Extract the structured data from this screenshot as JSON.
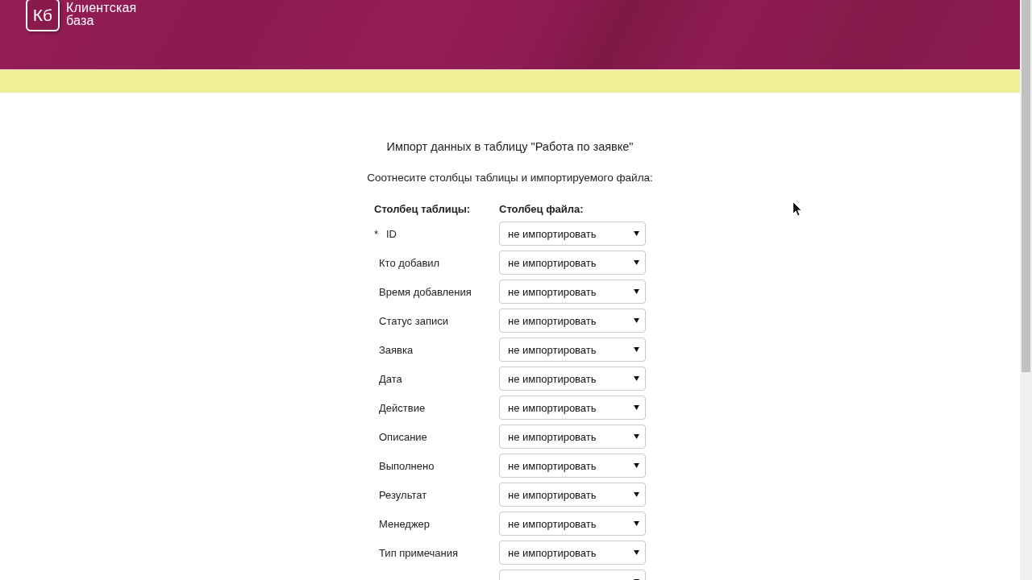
{
  "header": {
    "logo_mark": "Кб",
    "logo_text": "Клиентская база"
  },
  "import": {
    "title": "Импорт данных в таблицу \"Работа по заявке\"",
    "instruction": "Соотнесите столбцы таблицы и импортируемого файла:",
    "columns": [
      "Столбец таблицы:",
      "Столбец файла:"
    ],
    "rows": [
      {
        "marker": "*",
        "name": "ID",
        "value": "не импортировать"
      },
      {
        "name": "Кто добавил",
        "value": "не импортировать"
      },
      {
        "name": "Время добавления",
        "value": "не импортировать"
      },
      {
        "name": "Статус записи",
        "value": "не импортировать"
      },
      {
        "name": "Заявка",
        "value": "не импортировать"
      },
      {
        "name": "Дата",
        "value": "не импортировать"
      },
      {
        "name": "Действие",
        "value": "не импортировать"
      },
      {
        "name": "Описание",
        "value": "не импортировать"
      },
      {
        "name": "Выполнено",
        "value": "не импортировать"
      },
      {
        "name": "Результат",
        "value": "не импортировать"
      },
      {
        "name": "Менеджер",
        "value": "не импортировать"
      },
      {
        "name": "Тип примечания",
        "value": "не импортировать"
      },
      {}
    ]
  }
}
